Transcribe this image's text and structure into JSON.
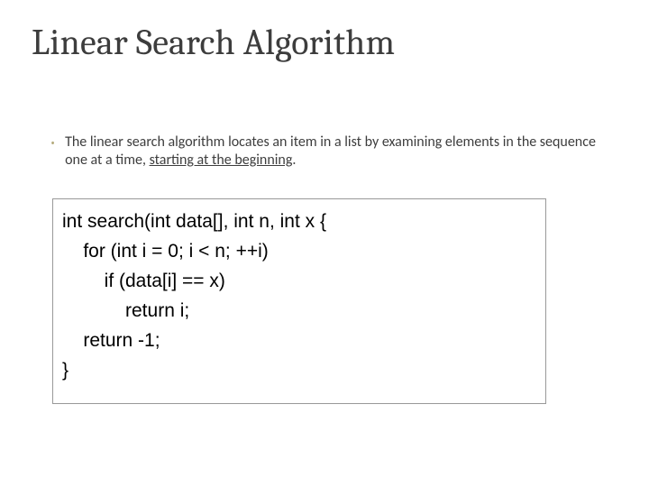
{
  "title": "Linear Search Algorithm",
  "bullet": {
    "text_plain": "The linear search algorithm locates an item in a list by examining elements in the sequence one at a time, ",
    "text_underlined": "starting at the beginning",
    "text_tail": "."
  },
  "code": {
    "l1": "int search(int data[], int n, int x {",
    "l2": "    for (int i = 0; i < n; ++i)",
    "l3": "        if (data[i] == x)",
    "l4": "            return i;",
    "l5": "    return -1;",
    "l6": "}"
  }
}
